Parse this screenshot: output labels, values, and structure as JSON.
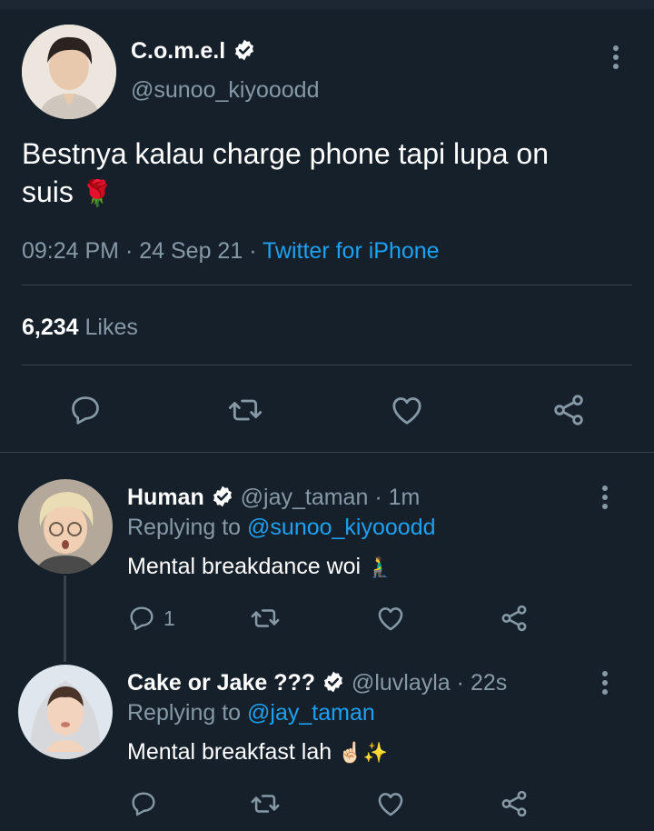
{
  "main_tweet": {
    "display_name": "C.o.m.e.l",
    "handle": "@sunoo_kiyooodd",
    "text": "Bestnya kalau charge phone tapi lupa on suis",
    "text_line1": "Bestnya kalau charge phone tapi lupa on",
    "text_line2": "suis",
    "emoji": "🌹",
    "time": "09:24 PM",
    "date": "24 Sep 21",
    "separator": "·",
    "source": "Twitter for iPhone",
    "likes_count": "6,234",
    "likes_label": "Likes"
  },
  "replies": [
    {
      "display_name": "Human",
      "handle": "@jay_taman",
      "time_ago": "1m",
      "replying_to_label": "Replying to",
      "replying_to": "@sunoo_kiyooodd",
      "text": "Mental breakdance woi",
      "emoji": "🧎‍♂️",
      "reply_count": "1"
    },
    {
      "display_name": "Cake or Jake ???",
      "handle": "@luvlayla",
      "time_ago": "22s",
      "replying_to_label": "Replying to",
      "replying_to": "@jay_taman",
      "text": "Mental breakfast lah",
      "emoji": "☝🏻✨",
      "reply_count": ""
    }
  ],
  "colors": {
    "background": "#15202b",
    "text": "#ffffff",
    "muted": "#8899a6",
    "link": "#1da1f2",
    "divider": "#38444d"
  },
  "icons": [
    "reply-icon",
    "retweet-icon",
    "like-icon",
    "share-icon",
    "more-icon",
    "verified-icon"
  ]
}
